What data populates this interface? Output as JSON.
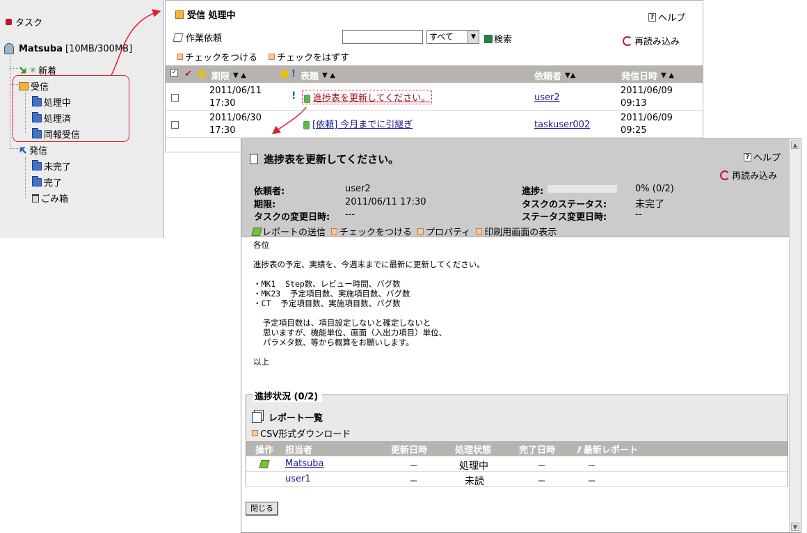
{
  "sidebar": {
    "title": "タスク",
    "user": {
      "name": "Matsuba",
      "quota": "[10MB/300MB]"
    },
    "items": {
      "shinchaku": "新着",
      "jushin": "受信",
      "shorichu": "処理中",
      "shorizumi": "処理済",
      "dohou": "同報受信",
      "hasshin": "発信",
      "mikanryo": "未完了",
      "kanryo": "完了",
      "gomibako": "ごみ箱"
    }
  },
  "list": {
    "title": "受信 処理中",
    "help": "ヘルプ",
    "new_task": "作業依頼",
    "search_placeholder": "",
    "filter_value": "すべて",
    "search_button": "検索",
    "reload": "再読み込み",
    "check_on": "チェックをつける",
    "check_off": "チェックをはずす",
    "columns": {
      "deadline": "期限",
      "subject": "表題",
      "requester": "依頼者",
      "sent": "発信日時"
    },
    "rows": [
      {
        "deadline_date": "2011/06/11",
        "deadline_time": "17:30",
        "subject": "進捗表を更新してください。",
        "requester": "user2",
        "sent_date": "2011/06/09",
        "sent_time": "09:13"
      },
      {
        "deadline_date": "2011/06/30",
        "deadline_time": "17:30",
        "subject": "[依頼] 今月までに引継ぎ",
        "requester": "taskuser002",
        "sent_date": "2011/06/09",
        "sent_time": "09:25"
      }
    ]
  },
  "detail": {
    "title": "進捗表を更新してください。",
    "help": "ヘルプ",
    "reload": "再読み込み",
    "labels": {
      "requester": "依頼者:",
      "deadline": "期限:",
      "changed": "タスクの変更日時:",
      "progress": "進捗:",
      "task_status": "タスクのステータス:",
      "status_changed": "ステータス変更日時:"
    },
    "values": {
      "requester": "user2",
      "deadline": "2011/06/11 17:30",
      "changed": "---",
      "progress": "0% (0/2)",
      "progress_fraction": 0,
      "task_status": "未完了",
      "status_changed": "--"
    },
    "actions": {
      "send_report": "レポートの送信",
      "check_on": "チェックをつける",
      "property": "プロパティ",
      "print": "印刷用画面の表示"
    },
    "body": "各位\n\n進捗表の予定、実績を、今週末までに最新に更新してください。\n\n・MK1  Step数、レビュー時間、バグ数\n・MK23  予定項目数、実施項目数、バグ数\n・CT  予定項目数、実施項目数、バグ数\n\n  予定項目数は、項目設定しないと確定しないと\n  思いますが、機能単位、画面（入出力項目）単位、\n  パラメタ数、等から概算をお願いします。\n\n以上",
    "progress_section": {
      "legend": "進捗状況 (0/2)",
      "report_list": "レポート一覧",
      "csv": "CSV形式ダウンロード",
      "columns": {
        "op": "操作",
        "assignee": "担当者",
        "updated": "更新日時",
        "state": "処理状態",
        "done": "完了日時",
        "latest": "最新レポート"
      },
      "rows": [
        {
          "assignee": "Matsuba",
          "updated": "－",
          "state": "処理中",
          "done": "－",
          "latest": "－"
        },
        {
          "assignee": "user1",
          "updated": "－",
          "state": "未読",
          "done": "－",
          "latest": "－"
        }
      ]
    },
    "close": "閉じる"
  }
}
